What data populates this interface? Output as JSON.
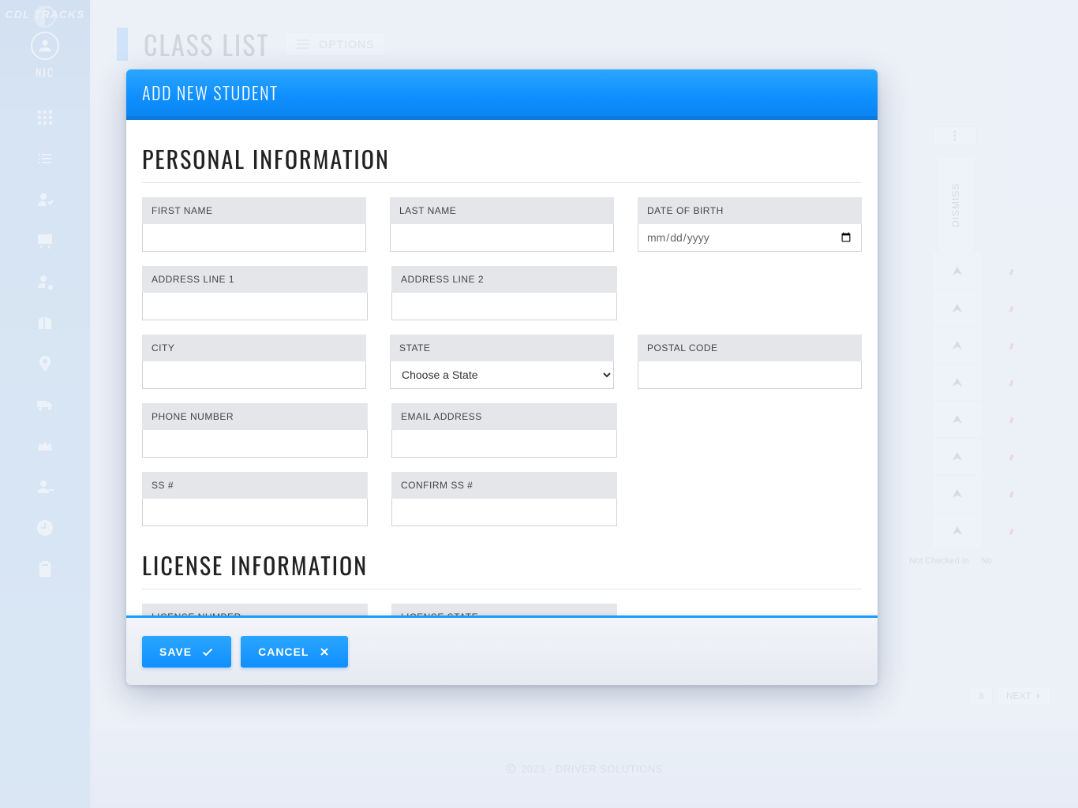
{
  "app": {
    "logo_text": "CDL TRACKS",
    "username": "NIC"
  },
  "page": {
    "title": "CLASS LIST",
    "options_label": "OPTIONS",
    "dismiss_label": "DISMISS",
    "not_checked_in": "Not Checked In",
    "no_label": "No",
    "pager": {
      "page": "8",
      "next": "NEXT"
    }
  },
  "footer": {
    "text": "2023 - DRIVER SOLUTIONS"
  },
  "modal": {
    "title": "ADD NEW STUDENT",
    "sections": {
      "personal": {
        "heading": "PERSONAL INFORMATION",
        "fields": {
          "first_name": "FIRST NAME",
          "last_name": "LAST NAME",
          "dob": "DATE OF BIRTH",
          "dob_placeholder": "mm/dd/yyyy",
          "addr1": "ADDRESS LINE 1",
          "addr2": "ADDRESS LINE 2",
          "city": "CITY",
          "state": "STATE",
          "state_placeholder": "Choose a State",
          "postal": "POSTAL CODE",
          "phone": "PHONE NUMBER",
          "email": "EMAIL ADDRESS",
          "ssn": "SS #",
          "ssn_confirm": "CONFIRM SS #"
        }
      },
      "license": {
        "heading": "LICENSE INFORMATION",
        "fields": {
          "number": "LICENSE NUMBER",
          "state": "LICENSE STATE"
        }
      }
    },
    "buttons": {
      "save": "SAVE",
      "cancel": "CANCEL"
    }
  }
}
